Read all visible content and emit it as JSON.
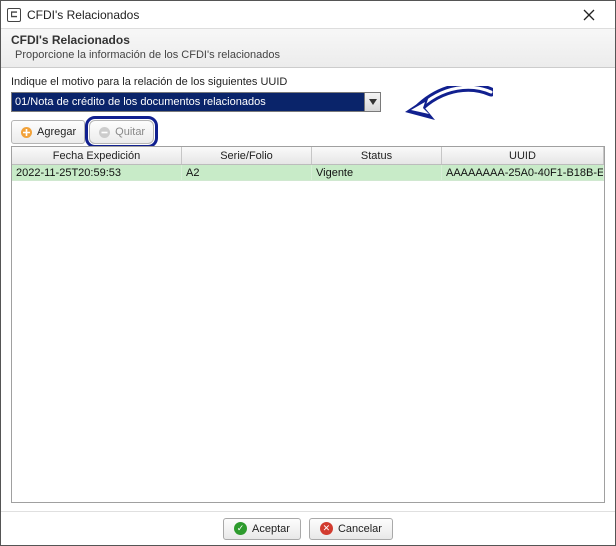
{
  "window": {
    "title": "CFDI's Relacionados"
  },
  "header": {
    "title": "CFDI's Relacionados",
    "subtitle": "Proporcione la información de los CFDI's relacionados"
  },
  "motivo": {
    "label": "Indique el motivo para la relación de los siguientes UUID",
    "selected": "01/Nota de crédito de los documentos relacionados"
  },
  "toolbar": {
    "agregar": "Agregar",
    "quitar": "Quitar"
  },
  "grid": {
    "columns": {
      "fecha": "Fecha Expedición",
      "serie": "Serie/Folio",
      "status": "Status",
      "uuid": "UUID"
    },
    "rows": [
      {
        "fecha": "2022-11-25T20:59:53",
        "serie": "A2",
        "status": "Vigente",
        "uuid": "AAAAAAAA-25A0-40F1-B18B-EB..."
      }
    ]
  },
  "footer": {
    "accept": "Aceptar",
    "cancel": "Cancelar"
  }
}
